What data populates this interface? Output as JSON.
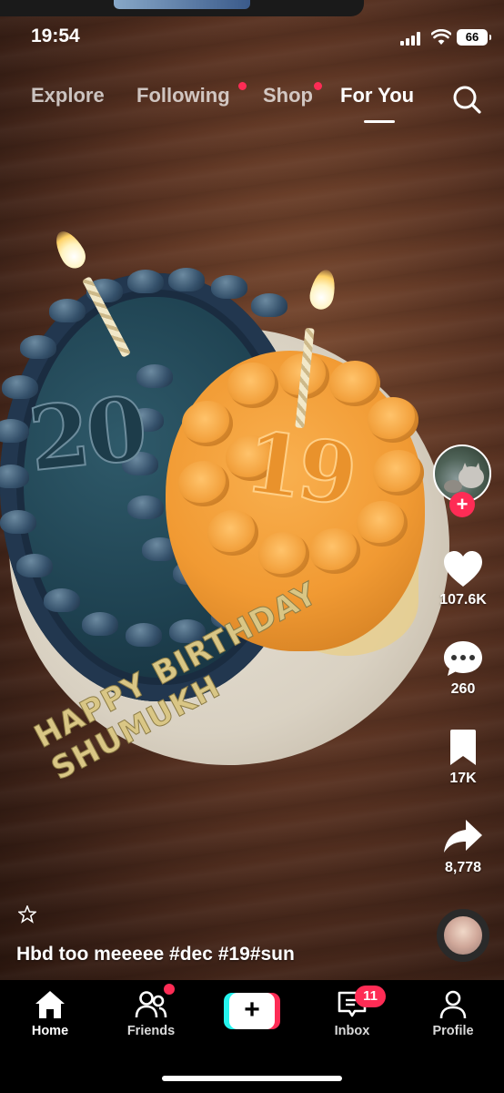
{
  "status_bar": {
    "time": "19:54",
    "battery": "66"
  },
  "top_nav": {
    "tabs": [
      {
        "label": "Explore",
        "active": false,
        "dot": false
      },
      {
        "label": "Following",
        "active": false,
        "dot": true
      },
      {
        "label": "Shop",
        "active": false,
        "dot": true
      },
      {
        "label": "For You",
        "active": true,
        "dot": false
      }
    ],
    "search_icon": "search-icon"
  },
  "video": {
    "cake_number_left": "20",
    "cake_number_right": "19",
    "cake_writing": "HAPPY BIRTHDAY SHUMUKH"
  },
  "right_rail": {
    "like_count": "107.6K",
    "comment_count": "260",
    "bookmark_count": "17K",
    "share_count": "8,778"
  },
  "caption": "Hbd too meeeee #dec #19#sun",
  "bottom_bar": {
    "tabs": [
      {
        "label": "Home",
        "icon": "home-icon",
        "active": true
      },
      {
        "label": "Friends",
        "icon": "friends-icon",
        "active": false
      },
      {
        "label": "Inbox",
        "icon": "inbox-icon",
        "active": false
      },
      {
        "label": "Profile",
        "icon": "profile-icon",
        "active": false
      }
    ],
    "inbox_badge": "11"
  },
  "colors": {
    "accent": "#fe2c55",
    "cyan": "#25f4ee"
  }
}
